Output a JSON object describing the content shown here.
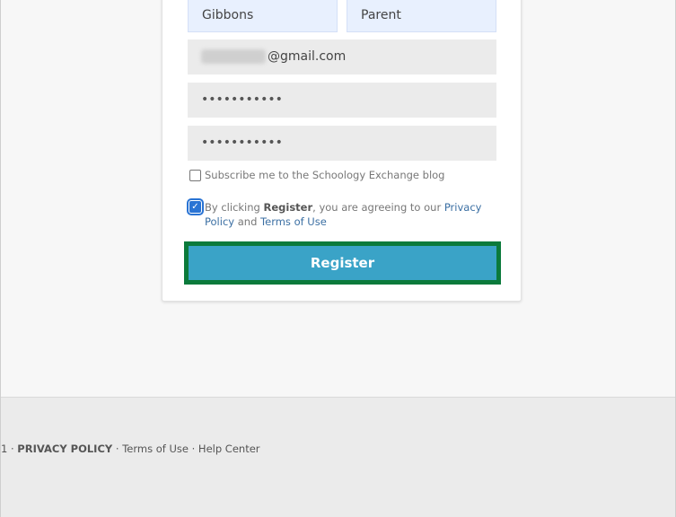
{
  "form": {
    "first_name": "Gibbons",
    "last_name": "Parent",
    "email_suffix": "@gmail.com",
    "password_mask": "•••••••••••",
    "confirm_password_mask": "•••••••••••",
    "subscribe_label": "Subscribe me to the Schoology Exchange blog",
    "terms_prefix": "By clicking ",
    "terms_register": "Register",
    "terms_middle": ", you are agreeing to our ",
    "privacy_link": "Privacy Policy",
    "terms_and": " and ",
    "terms_link": "Terms of Use",
    "register_label": "Register",
    "terms_checked": true,
    "subscribe_checked": false
  },
  "footer": {
    "prefix": "1 · ",
    "privacy_policy": "PRIVACY POLICY",
    "sep1": " · ",
    "terms_of_use": "Terms of Use",
    "sep2": " · ",
    "help_center": "Help Center"
  },
  "colors": {
    "register_button": "#3aa3c7",
    "highlight_border": "#0b7a3b",
    "link": "#3b6fa3",
    "checkbox_checked": "#2a74d4"
  }
}
